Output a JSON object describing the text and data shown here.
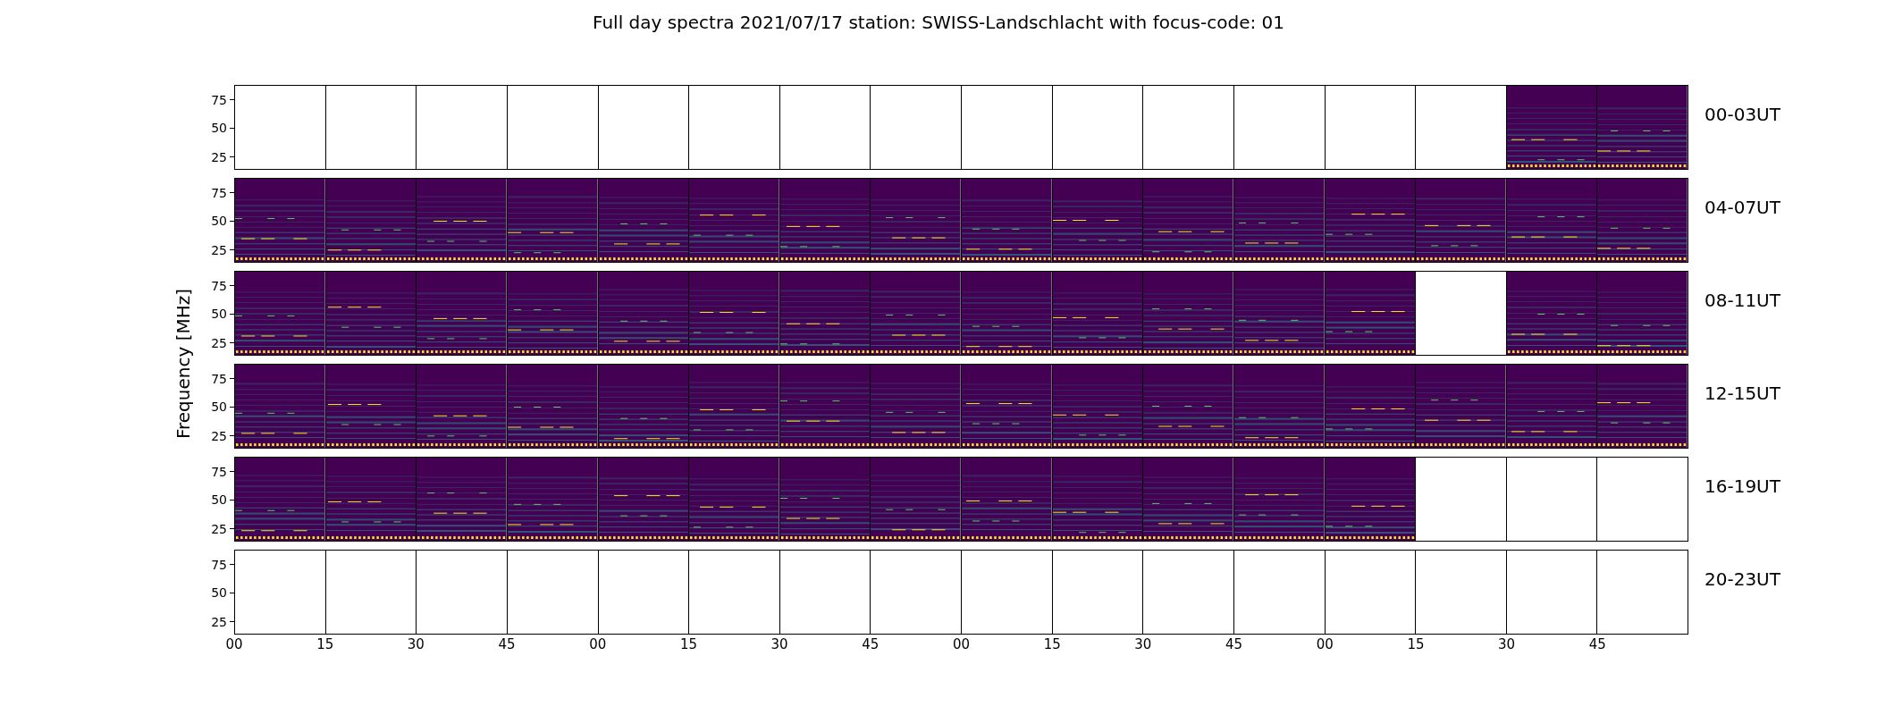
{
  "title": "Full day spectra 2021/07/17 station: SWISS-Landschlacht with focus-code: 01",
  "ylabel": "Frequency [MHz]",
  "xticks": [
    "00",
    "15",
    "30",
    "45",
    "00",
    "15",
    "30",
    "45",
    "00",
    "15",
    "30",
    "45",
    "00",
    "15",
    "30",
    "45"
  ],
  "rows": [
    {
      "label": "00-03UT",
      "yticks": [
        "75",
        "50",
        "25"
      ],
      "panels": [
        {
          "kind": "blank"
        },
        {
          "kind": "blank"
        },
        {
          "kind": "blank"
        },
        {
          "kind": "blank"
        },
        {
          "kind": "blank"
        },
        {
          "kind": "blank"
        },
        {
          "kind": "blank"
        },
        {
          "kind": "blank"
        },
        {
          "kind": "blank"
        },
        {
          "kind": "blank"
        },
        {
          "kind": "blank"
        },
        {
          "kind": "blank"
        },
        {
          "kind": "blank"
        },
        {
          "kind": "blank"
        },
        {
          "kind": "spectrum"
        },
        {
          "kind": "spectrum"
        }
      ]
    },
    {
      "label": "04-07UT",
      "yticks": [
        "75",
        "50",
        "25"
      ],
      "panels": [
        {
          "kind": "spectrum"
        },
        {
          "kind": "spectrum"
        },
        {
          "kind": "spectrum"
        },
        {
          "kind": "spectrum"
        },
        {
          "kind": "spectrum"
        },
        {
          "kind": "spectrum"
        },
        {
          "kind": "spectrum"
        },
        {
          "kind": "spectrum"
        },
        {
          "kind": "spectrum"
        },
        {
          "kind": "spectrum"
        },
        {
          "kind": "spectrum"
        },
        {
          "kind": "spectrum"
        },
        {
          "kind": "spectrum"
        },
        {
          "kind": "spectrum"
        },
        {
          "kind": "spectrum"
        },
        {
          "kind": "spectrum"
        }
      ]
    },
    {
      "label": "08-11UT",
      "yticks": [
        "75",
        "50",
        "25"
      ],
      "panels": [
        {
          "kind": "spectrum"
        },
        {
          "kind": "spectrum"
        },
        {
          "kind": "spectrum"
        },
        {
          "kind": "spectrum"
        },
        {
          "kind": "spectrum"
        },
        {
          "kind": "spectrum"
        },
        {
          "kind": "spectrum"
        },
        {
          "kind": "spectrum"
        },
        {
          "kind": "spectrum"
        },
        {
          "kind": "spectrum"
        },
        {
          "kind": "spectrum"
        },
        {
          "kind": "spectrum"
        },
        {
          "kind": "spectrum"
        },
        {
          "kind": "blank"
        },
        {
          "kind": "spectrum"
        },
        {
          "kind": "spectrum"
        }
      ]
    },
    {
      "label": "12-15UT",
      "yticks": [
        "75",
        "50",
        "25"
      ],
      "panels": [
        {
          "kind": "spectrum"
        },
        {
          "kind": "spectrum"
        },
        {
          "kind": "spectrum"
        },
        {
          "kind": "spectrum"
        },
        {
          "kind": "spectrum"
        },
        {
          "kind": "spectrum"
        },
        {
          "kind": "spectrum"
        },
        {
          "kind": "spectrum"
        },
        {
          "kind": "spectrum"
        },
        {
          "kind": "spectrum"
        },
        {
          "kind": "spectrum"
        },
        {
          "kind": "spectrum"
        },
        {
          "kind": "spectrum"
        },
        {
          "kind": "spectrum"
        },
        {
          "kind": "spectrum"
        },
        {
          "kind": "spectrum"
        }
      ]
    },
    {
      "label": "16-19UT",
      "yticks": [
        "75",
        "50",
        "25"
      ],
      "panels": [
        {
          "kind": "spectrum"
        },
        {
          "kind": "spectrum"
        },
        {
          "kind": "spectrum"
        },
        {
          "kind": "spectrum"
        },
        {
          "kind": "spectrum"
        },
        {
          "kind": "spectrum"
        },
        {
          "kind": "spectrum"
        },
        {
          "kind": "spectrum"
        },
        {
          "kind": "spectrum"
        },
        {
          "kind": "spectrum"
        },
        {
          "kind": "spectrum"
        },
        {
          "kind": "spectrum"
        },
        {
          "kind": "spectrum"
        },
        {
          "kind": "blank"
        },
        {
          "kind": "blank"
        },
        {
          "kind": "blank"
        }
      ]
    },
    {
      "label": "20-23UT",
      "yticks": [
        "75",
        "50",
        "25"
      ],
      "panels": [
        {
          "kind": "blank"
        },
        {
          "kind": "blank"
        },
        {
          "kind": "blank"
        },
        {
          "kind": "blank"
        },
        {
          "kind": "blank"
        },
        {
          "kind": "blank"
        },
        {
          "kind": "blank"
        },
        {
          "kind": "blank"
        },
        {
          "kind": "blank"
        },
        {
          "kind": "blank"
        },
        {
          "kind": "blank"
        },
        {
          "kind": "blank"
        },
        {
          "kind": "blank"
        },
        {
          "kind": "blank"
        },
        {
          "kind": "blank"
        },
        {
          "kind": "blank"
        }
      ]
    }
  ]
}
